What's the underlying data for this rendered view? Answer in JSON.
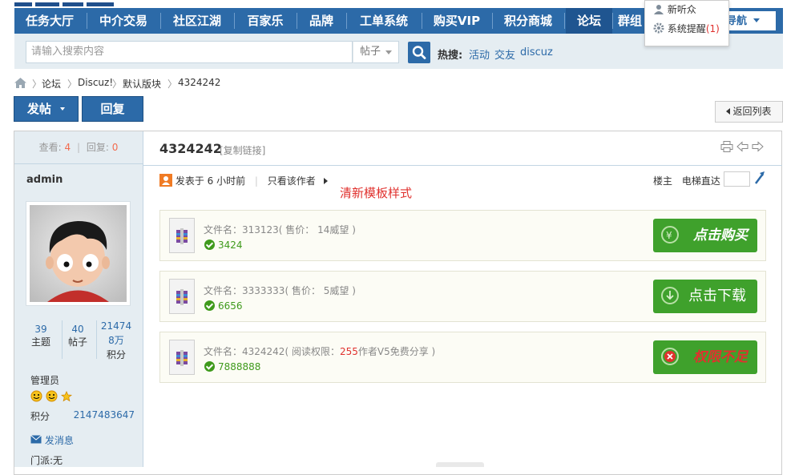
{
  "nav": {
    "items": [
      "任务大厅",
      "中介交易",
      "社区江湖",
      "百家乐",
      "品牌",
      "工单系统",
      "购买VIP",
      "积分商城",
      "论坛",
      "群组"
    ],
    "active_index": 8,
    "daohang_label": "导航"
  },
  "user_menu": {
    "items": [
      "新听众",
      "系统提醒"
    ],
    "reminder_count": "(1)"
  },
  "search": {
    "placeholder": "请输入搜索内容",
    "type": "帖子",
    "hot_label": "热搜:",
    "hot_links": [
      "活动",
      "交友",
      "discuz"
    ]
  },
  "breadcrumb": {
    "items": [
      "论坛",
      "Discuz!",
      "默认版块",
      "4324242"
    ]
  },
  "buttons": {
    "post": "发帖",
    "reply": "回复",
    "back": "返回列表"
  },
  "thread": {
    "views_label": "查看:",
    "views": "4",
    "replies_label": "回复:",
    "replies": "0",
    "title": "4324242",
    "copy_link": "[复制链接]",
    "posted": "发表于 6 小时前",
    "only_author": "只看该作者",
    "floor_owner": "楼主",
    "jump_label": "电梯直达",
    "annotation": "清新模板样式"
  },
  "author": {
    "name": "admin",
    "stats": [
      {
        "value": "39",
        "label": "主题"
      },
      {
        "value": "40",
        "label": "帖子"
      },
      {
        "value": "214748万",
        "label": "积分"
      }
    ],
    "group": "管理员",
    "points_label": "积分",
    "points_value": "2147483647",
    "send_msg": "发消息",
    "faction": "门派:无"
  },
  "attachments": [
    {
      "name": "文件名：313123( 售价：  14威望 )",
      "count": "3424",
      "action": "点击购买",
      "action_style": "italic-white"
    },
    {
      "name": "文件名：3333333( 售价：  5威望 )",
      "count": "6656",
      "action": "点击下载",
      "action_style": "plain"
    },
    {
      "name_prefix": "文件名：4324242( 阅读权限：",
      "name_red": "255",
      "name_suffix": "作者V5免费分享 )",
      "count": "7888888",
      "action": "权限不足",
      "action_style": "italic-red"
    }
  ],
  "colors": {
    "nav_bg": "#2c6aa8",
    "band_bg": "#e5edf2",
    "green_btn": "#3fa12c",
    "accent_red": "#e0312e"
  }
}
